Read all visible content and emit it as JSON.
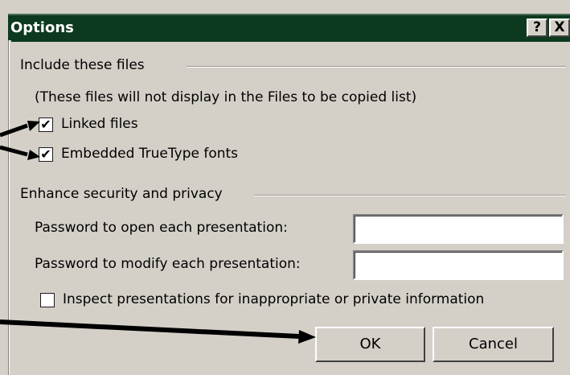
{
  "dialog": {
    "title": "Options",
    "help_label": "?",
    "close_label": "X"
  },
  "include_section": {
    "heading": "Include these files",
    "note": "(These files will not display in the Files to be copied list)",
    "linked_files": {
      "label": "Linked files",
      "checked": true
    },
    "embedded_fonts": {
      "label": "Embedded TrueType fonts",
      "checked": true
    }
  },
  "security_section": {
    "heading": "Enhance security and privacy",
    "password_open": {
      "label": "Password to open each presentation:",
      "value": ""
    },
    "password_modify": {
      "label": "Password to modify each presentation:",
      "value": ""
    },
    "inspect": {
      "label": "Inspect presentations for inappropriate or private information",
      "checked": false
    }
  },
  "buttons": {
    "ok": "OK",
    "cancel": "Cancel"
  },
  "check_glyph": "✔",
  "colors": {
    "title_bar": "#0d3a1e",
    "dialog_face": "#d4d0c8",
    "arrow": "#000000"
  }
}
